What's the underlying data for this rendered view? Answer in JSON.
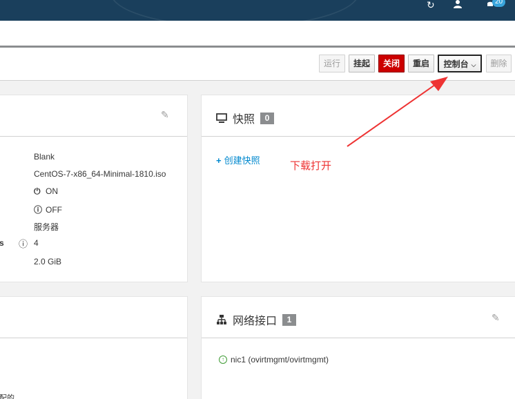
{
  "header": {
    "refresh_icon": "↻",
    "user_icon": "👤",
    "bell_icon": "🔔",
    "bell_count": "20"
  },
  "toolbar": {
    "run_label": "运行",
    "suspend_label": "挂起",
    "shutdown_label": "关闭",
    "reboot_label": "重启",
    "console_label": "控制台",
    "delete_label": "删除"
  },
  "details": {
    "rows": [
      {
        "value": "Blank"
      },
      {
        "value": "CentOS-7-x86_64-Minimal-1810.iso"
      },
      {
        "icon": "⏻",
        "value": "ON"
      },
      {
        "icon": "ⓘ",
        "value": "OFF"
      },
      {
        "value": "服务器"
      },
      {
        "label_fragment": "s",
        "value": "4"
      },
      {
        "value": "2.0 GiB"
      }
    ]
  },
  "snapshots": {
    "title": "快照",
    "count": "0",
    "create_label": "创建快照"
  },
  "annotation": {
    "text": "下载打开"
  },
  "network": {
    "title": "网络接口",
    "count": "1",
    "nic": "nic1  (ovirtmgmt/ovirtmgmt)"
  },
  "bottom_left_fragment": "配的",
  "colors": {
    "header_bg": "#1a3f5c",
    "danger": "#cc0000",
    "link": "#0088ce",
    "annotation": "#ee3333"
  }
}
